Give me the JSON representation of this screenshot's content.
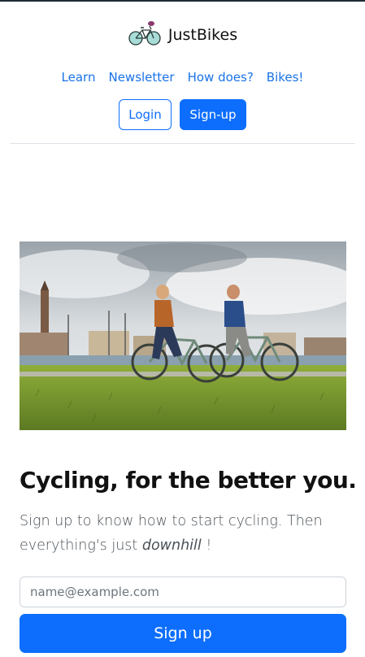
{
  "brand": {
    "name": "JustBikes",
    "logo_icon": "bicycle-icon"
  },
  "nav": {
    "items": [
      "Learn",
      "Newsletter",
      "How does?",
      "Bikes!"
    ]
  },
  "auth": {
    "login_label": "Login",
    "signup_label": "Sign-up"
  },
  "hero": {
    "headline": "Cycling, for the better you.",
    "lead_prefix": "Sign up to know how to start cycling. Then everything's just ",
    "lead_emphasis": "downhill",
    "lead_suffix": " !"
  },
  "signup_form": {
    "email_placeholder": "name@example.com",
    "email_value": "",
    "submit_label": "Sign up"
  },
  "colors": {
    "primary": "#0d6efd",
    "link": "#1a73e8",
    "text": "#111111",
    "muted": "#495057"
  }
}
